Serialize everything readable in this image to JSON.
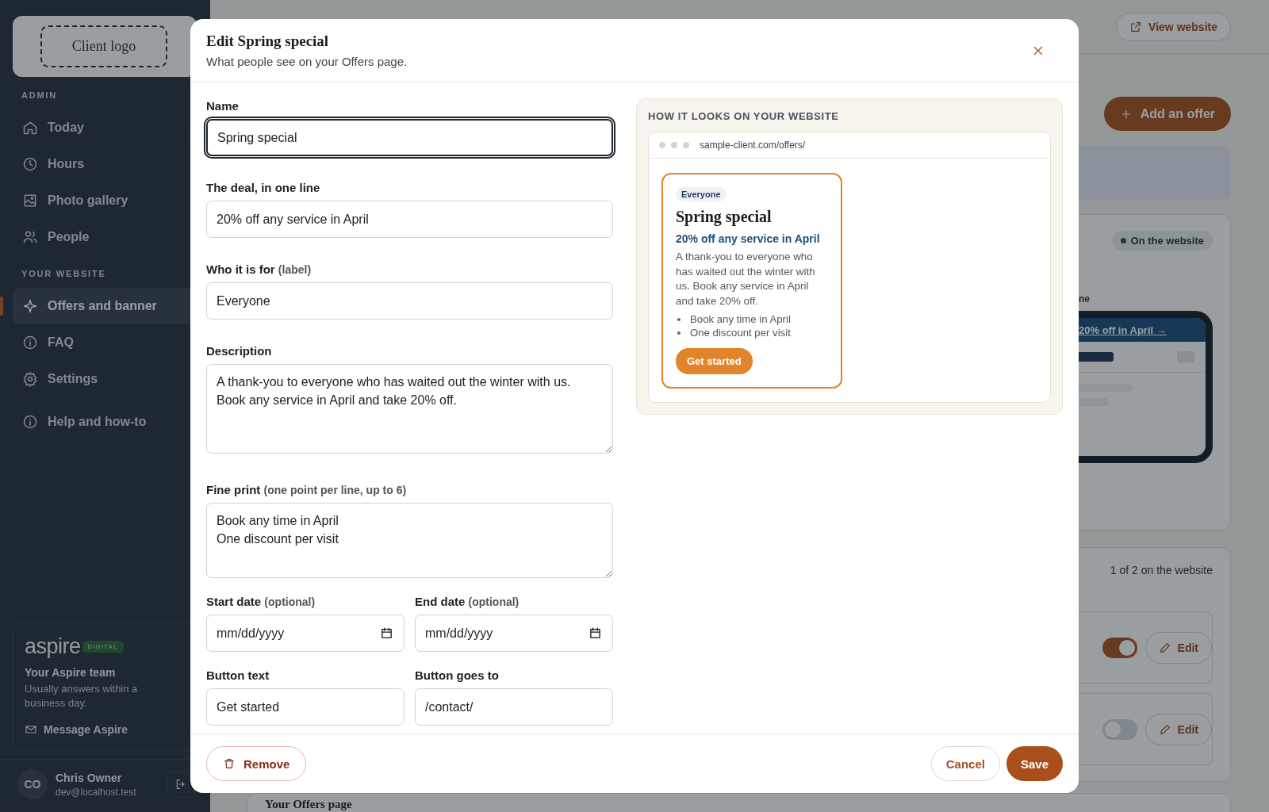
{
  "sidebar": {
    "logo": "Client logo",
    "sections": [
      {
        "heading": "ADMIN",
        "items": [
          {
            "label": "Today",
            "selected": false
          },
          {
            "label": "Hours",
            "selected": false
          },
          {
            "label": "Photo gallery",
            "selected": false
          },
          {
            "label": "People",
            "selected": false
          }
        ]
      },
      {
        "heading": "YOUR WEBSITE",
        "items": [
          {
            "label": "Offers and banner",
            "selected": true
          },
          {
            "label": "FAQ",
            "selected": false
          },
          {
            "label": "Settings",
            "selected": false
          }
        ]
      }
    ],
    "help": "Help and how-to",
    "support": {
      "brand": "aspire",
      "brand_tag": "DIGITAL",
      "title": "Your Aspire team",
      "text": "Usually answers within a business day.",
      "link": "Message Aspire"
    },
    "user": {
      "initials": "CO",
      "name": "Chris Owner",
      "email": "dev@localhost.test"
    }
  },
  "page": {
    "view_website": "View website",
    "add_offer": "Add an offer",
    "status_badge": "On the website",
    "label_fragment": "ne",
    "phone_banner": "20% off in April →",
    "count": "1 of 2 on the website",
    "offers": [
      {
        "on": true,
        "edit": "Edit"
      },
      {
        "on": false,
        "edit": "Edit"
      }
    ],
    "section_title": "Your Offers page"
  },
  "modal": {
    "title": "Edit Spring special",
    "subtitle": "What people see on your Offers page.",
    "fields": [
      {
        "kind": "input",
        "label": "Name",
        "value": "Spring special",
        "focused": true
      },
      {
        "kind": "input",
        "label": "The deal, in one line",
        "value": "20% off any service in April",
        "focused": false
      },
      {
        "kind": "input",
        "label": "Who it is for",
        "hint": "(label)",
        "value": "Everyone",
        "focused": false
      },
      {
        "kind": "textarea",
        "label": "Description",
        "value": "A thank-you to everyone who has waited out the winter with us.\nBook any service in April and take 20% off.",
        "focused": false
      },
      {
        "kind": "textarea",
        "label": "Fine print",
        "hint": "(one point per line, up to 6)",
        "value": "Book any time in April\nOne discount per visit",
        "focused": false
      }
    ],
    "field_rows": [
      [
        {
          "kind": "date",
          "label": "Start date",
          "hint": "(optional)",
          "placeholder": "mm/dd/yyyy",
          "focused": false
        },
        {
          "kind": "date",
          "label": "End date",
          "hint": "(optional)",
          "placeholder": "mm/dd/yyyy",
          "focused": false
        }
      ],
      [
        {
          "kind": "input",
          "label": "Button text",
          "value": "Get started",
          "focused": false
        },
        {
          "kind": "input",
          "label": "Button goes to",
          "value": "/contact/",
          "focused": false
        }
      ]
    ],
    "preview": {
      "heading": "HOW IT LOOKS ON YOUR WEBSITE",
      "url": "sample-client.com/offers/",
      "badge": "Everyone",
      "title": "Spring special",
      "deal": "20% off any service in April",
      "description": "A thank-you to everyone who has waited out the winter with us. Book any service in April and take 20% off.",
      "bullets": [
        "Book any time in April",
        "One discount per visit"
      ],
      "button": "Get started"
    },
    "remove": "Remove",
    "cancel": "Cancel",
    "save": "Save"
  }
}
